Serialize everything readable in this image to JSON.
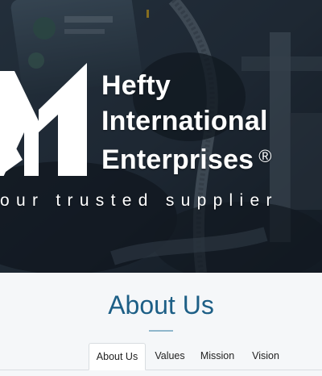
{
  "hero": {
    "brand_line_1": "Hefty",
    "brand_line_2": "International",
    "brand_line_3": "Enterprises",
    "registered_mark": "®",
    "tagline": "our trusted supplier",
    "logo_icon": "hefty-logo-icon"
  },
  "about": {
    "title": "About Us",
    "tabs": [
      {
        "label": "About Us",
        "active": true
      },
      {
        "label": "Values",
        "active": false
      },
      {
        "label": "Mission",
        "active": false
      },
      {
        "label": "Vision",
        "active": false
      }
    ]
  },
  "colors": {
    "heading_blue": "#1d5f86",
    "divider": "#8fb7cc",
    "hero_text": "#ffffff"
  }
}
